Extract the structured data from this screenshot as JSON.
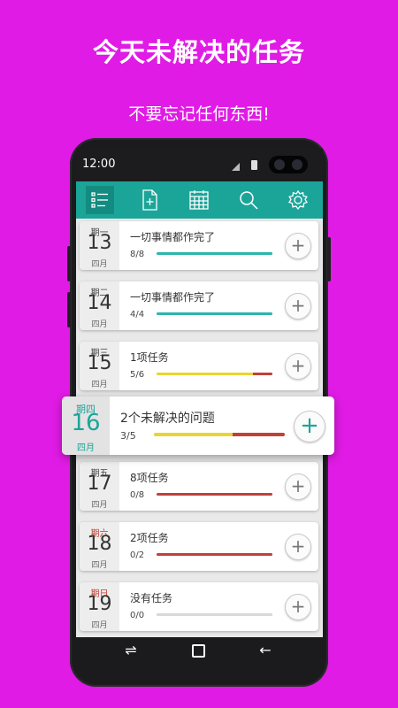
{
  "headline": "今天未解决的任务",
  "subline": "不要忘记任何东西!",
  "status": {
    "time": "12:00"
  },
  "toolbar": {
    "items": [
      {
        "icon": "task-list-icon",
        "active": true
      },
      {
        "icon": "new-document-icon",
        "active": false
      },
      {
        "icon": "calendar-icon",
        "active": false
      },
      {
        "icon": "search-icon",
        "active": false
      },
      {
        "icon": "settings-gear-icon",
        "active": false
      }
    ]
  },
  "days": [
    {
      "weekday": "期一",
      "day": "13",
      "month": "四月",
      "title": "一切事情都作完了",
      "count": "8/8",
      "progress": 1.0,
      "color": "#2bb5ad",
      "weekday_color": "normal"
    },
    {
      "weekday": "期二",
      "day": "14",
      "month": "四月",
      "title": "一切事情都作完了",
      "count": "4/4",
      "progress": 1.0,
      "color": "#2bb5ad",
      "weekday_color": "normal"
    },
    {
      "weekday": "期三",
      "day": "15",
      "month": "四月",
      "title": "1项任务",
      "count": "5/6",
      "progress": 0.83,
      "color": "#e8d530",
      "remainder_color": "#c0413a",
      "weekday_color": "normal"
    },
    {
      "weekday": "期五",
      "day": "17",
      "month": "四月",
      "title": "8项任务",
      "count": "0/8",
      "progress": 0.0,
      "color": "#c0413a",
      "weekday_color": "normal"
    },
    {
      "weekday": "期六",
      "day": "18",
      "month": "四月",
      "title": "2项任务",
      "count": "0/2",
      "progress": 0.0,
      "color": "#c0413a",
      "weekday_color": "red"
    },
    {
      "weekday": "期日",
      "day": "19",
      "month": "四月",
      "title": "没有任务",
      "count": "0/0",
      "progress": 0.0,
      "color": "#d8d8d8",
      "weekday_color": "red"
    }
  ],
  "highlight": {
    "weekday": "期四",
    "day": "16",
    "month": "四月",
    "title": "2个未解决的问题",
    "count": "3/5",
    "progress": 0.6,
    "color": "#e8d530",
    "remainder_color": "#c0413a"
  },
  "add_button_glyph": "+",
  "nav": {
    "recent": "recent-apps-icon",
    "home": "home-icon",
    "back": "back-icon"
  }
}
